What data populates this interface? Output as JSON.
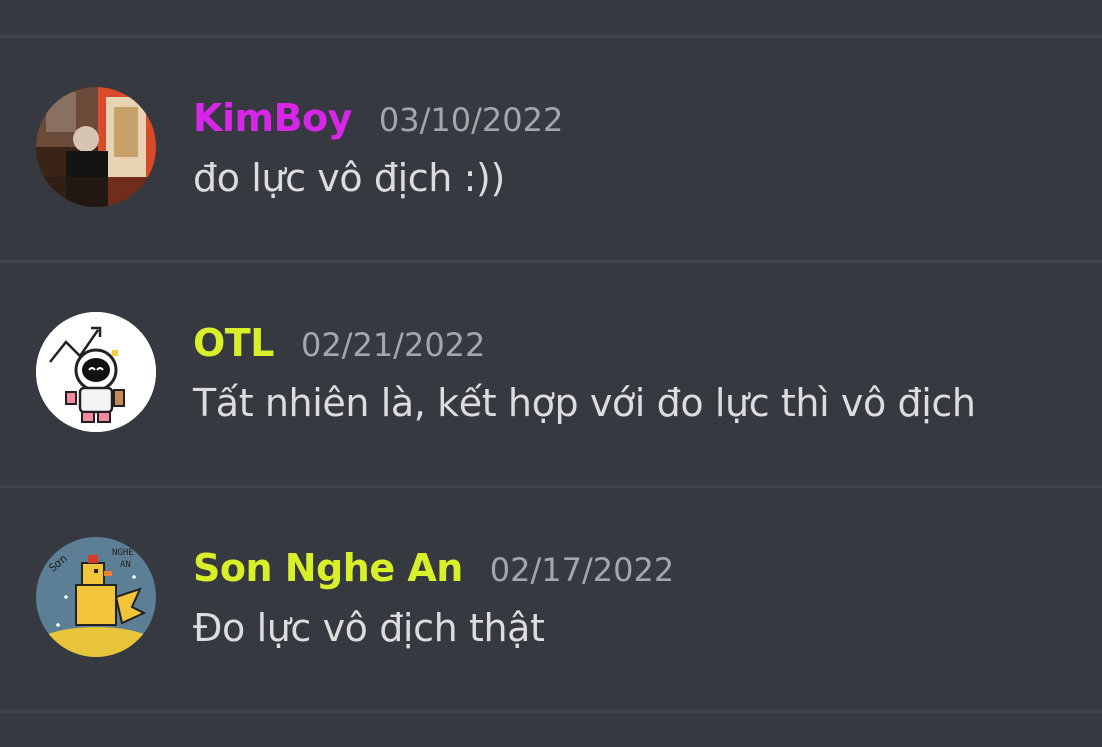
{
  "messages": [
    {
      "username": "KimBoy",
      "username_color": "#d726e8",
      "timestamp": "03/10/2022",
      "content": "đo lực vô địch :))",
      "avatar": "photo-avatar"
    },
    {
      "username": "OTL",
      "username_color": "#d7f02a",
      "timestamp": "02/21/2022",
      "content": "Tất nhiên là, kết hợp với đo lực thì vô địch",
      "avatar": "astronaut-avatar"
    },
    {
      "username": "Son Nghe An",
      "username_color": "#d7f02a",
      "timestamp": "02/17/2022",
      "content": "Đo lực vô địch thật",
      "avatar": "rooster-avatar"
    }
  ],
  "colors": {
    "background": "#36393f",
    "divider": "#41444a",
    "text": "#dcddde",
    "timestamp": "#a3a6aa"
  }
}
